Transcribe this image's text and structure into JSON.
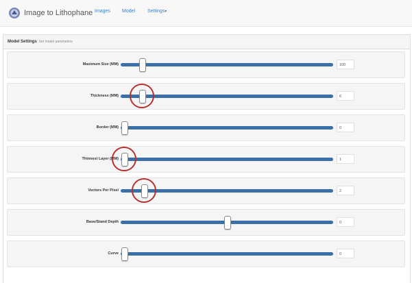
{
  "nav": {
    "brand": "Image to Lithophane",
    "links": [
      "Images",
      "Model",
      "Settings"
    ]
  },
  "panel": {
    "title": "Model Settings",
    "subtitle": "Set model parameters"
  },
  "settings": [
    {
      "label": "Maximum Size (MM)",
      "value": "100",
      "slider_fraction": 0.1
    },
    {
      "label": "Thickness (MM)",
      "value": "6",
      "slider_fraction": 0.1
    },
    {
      "label": "Border (MM)",
      "value": "0",
      "slider_fraction": 0.0
    },
    {
      "label": "Thinnest Layer (MM)",
      "value": "1",
      "slider_fraction": 0.0
    },
    {
      "label": "Vectors Per Pixel",
      "value": "2",
      "slider_fraction": 0.11
    },
    {
      "label": "Base/Stand Depth",
      "value": "0",
      "slider_fraction": 0.5
    },
    {
      "label": "Curve",
      "value": "0",
      "slider_fraction": 0.0
    }
  ],
  "highlighted_rows": [
    1,
    3,
    4
  ],
  "colors": {
    "slider_track": "#3a6fa8",
    "highlight_ring": "#b3312f",
    "nav_link": "#3f7fbf"
  }
}
